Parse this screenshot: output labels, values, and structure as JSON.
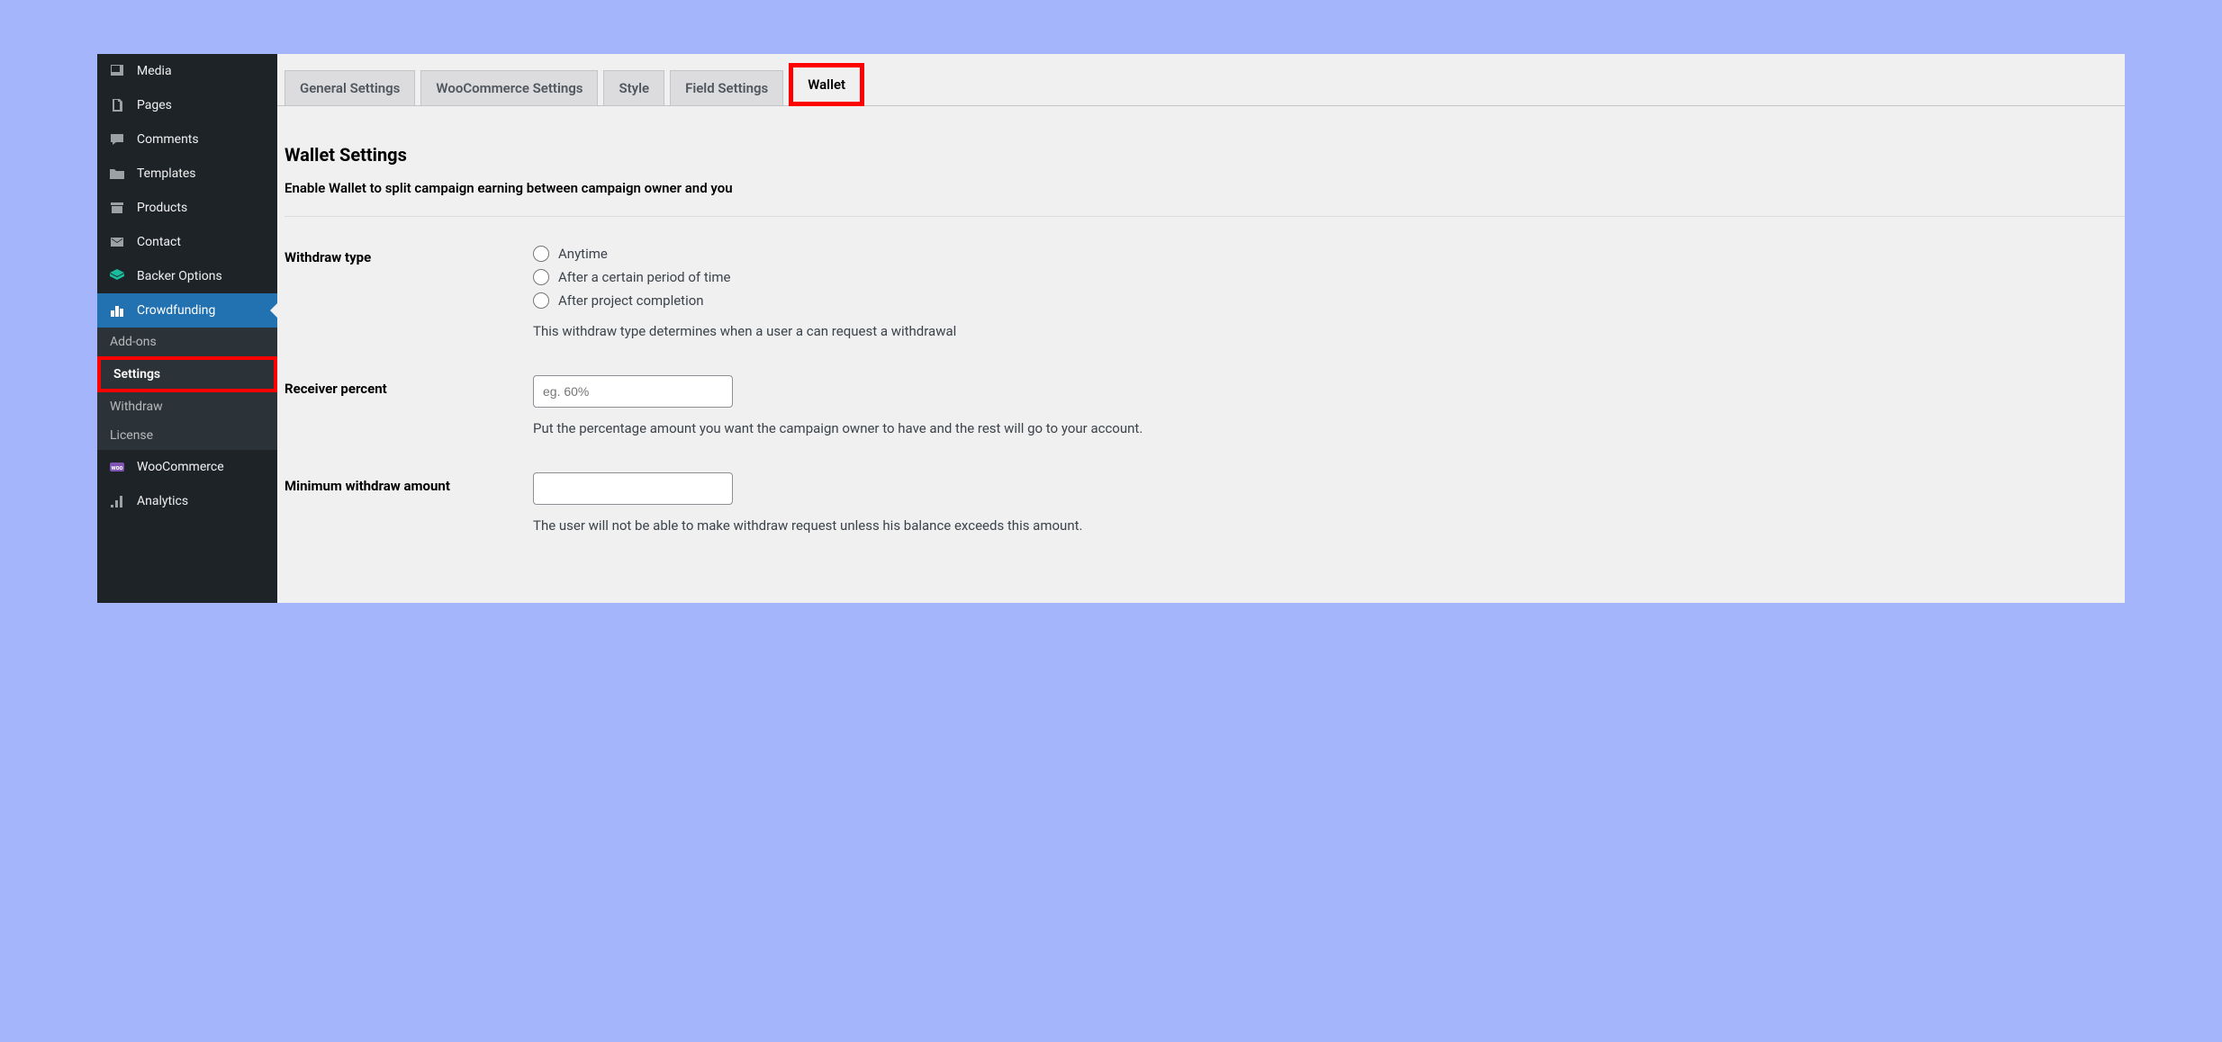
{
  "sidebar": {
    "main_items": [
      {
        "key": "media",
        "label": "Media"
      },
      {
        "key": "pages",
        "label": "Pages"
      },
      {
        "key": "comments",
        "label": "Comments"
      },
      {
        "key": "templates",
        "label": "Templates"
      },
      {
        "key": "products",
        "label": "Products"
      },
      {
        "key": "contact",
        "label": "Contact"
      },
      {
        "key": "backer",
        "label": "Backer Options"
      },
      {
        "key": "crowdfunding",
        "label": "Crowdfunding"
      }
    ],
    "submenu": [
      {
        "key": "addons",
        "label": "Add-ons"
      },
      {
        "key": "settings",
        "label": "Settings"
      },
      {
        "key": "withdraw",
        "label": "Withdraw"
      },
      {
        "key": "license",
        "label": "License"
      }
    ],
    "after_items": [
      {
        "key": "woocommerce",
        "label": "WooCommerce"
      },
      {
        "key": "analytics",
        "label": "Analytics"
      }
    ]
  },
  "tabs": [
    {
      "key": "general",
      "label": "General Settings"
    },
    {
      "key": "woo",
      "label": "WooCommerce Settings"
    },
    {
      "key": "style",
      "label": "Style"
    },
    {
      "key": "field",
      "label": "Field Settings"
    },
    {
      "key": "wallet",
      "label": "Wallet"
    }
  ],
  "wallet": {
    "title": "Wallet Settings",
    "description": "Enable Wallet to split campaign earning between campaign owner and you",
    "withdraw_type": {
      "label": "Withdraw type",
      "options": [
        "Anytime",
        "After a certain period of time",
        "After project completion"
      ],
      "help": "This withdraw type determines when a user a can request a withdrawal"
    },
    "receiver_percent": {
      "label": "Receiver percent",
      "placeholder": "eg. 60%",
      "value": "",
      "help": "Put the percentage amount you want the campaign owner to have and the rest will go to your account."
    },
    "min_withdraw": {
      "label": "Minimum withdraw amount",
      "value": "",
      "help": "The user will not be able to make withdraw request unless his balance exceeds this amount."
    }
  }
}
